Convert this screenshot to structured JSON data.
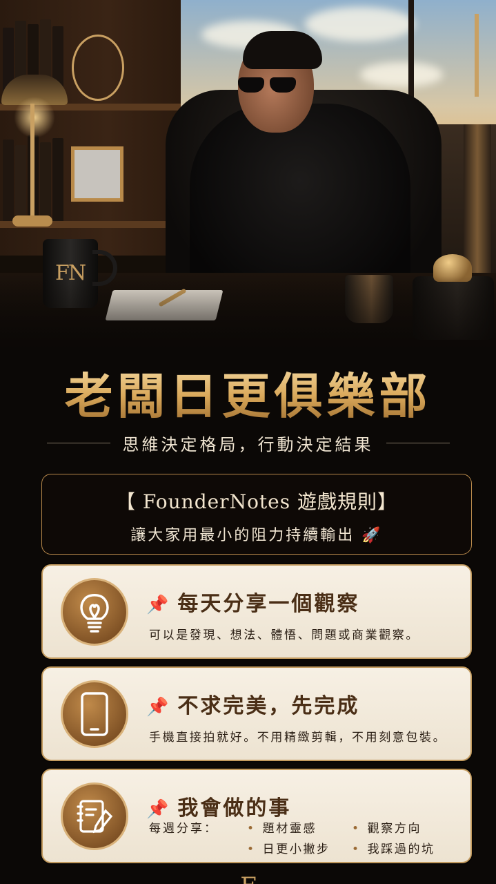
{
  "hero": {
    "mug_logo": "FN"
  },
  "header": {
    "title": "老闆日更俱樂部",
    "subtitle": "思維決定格局，行動決定結果"
  },
  "rules": {
    "title": "【 FounderNotes 遊戲規則】",
    "description": "讓大家用最小的阻力持續輸出 🚀"
  },
  "cards": [
    {
      "icon": "lightbulb-icon",
      "pin": "📌",
      "title": "每天分享一個觀察",
      "description": "可以是發現、想法、體悟、問題或商業觀察。"
    },
    {
      "icon": "smartphone-icon",
      "pin": "📌",
      "title": "不求完美，先完成",
      "description": "手機直接拍就好。不用精緻剪輯，不用刻意包裝。"
    },
    {
      "icon": "notebook-pen-icon",
      "pin": "📌",
      "title": "我會做的事",
      "label": "每週分享：",
      "bullets": [
        "題材靈感",
        "觀察方向",
        "日更小撇步",
        "我踩過的坑"
      ]
    }
  ],
  "footer": {
    "logo": "F"
  },
  "colors": {
    "gold": "#c9a062",
    "card_bg": "#f4ecdf",
    "title_brown": "#4a2e16",
    "background": "#0b0806"
  }
}
